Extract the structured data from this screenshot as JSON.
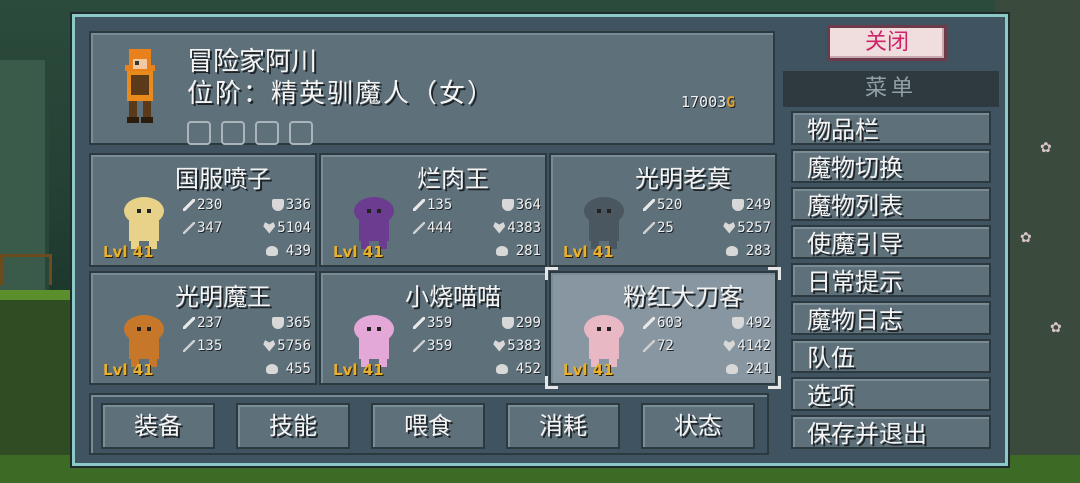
{
  "player": {
    "name": "冒险家阿川",
    "rank": "位阶：精英驯魔人（女）",
    "gold_amount": "17003",
    "gold_icon": "G",
    "equipment_slots": [
      "weapon-slot-icon",
      "armor-slot-icon",
      "helmet-slot-icon",
      "accessory-slot-icon"
    ]
  },
  "monsters": [
    {
      "name": "国服喷子",
      "level": "Lvl 41",
      "atk": "230",
      "def": "336",
      "matk": "347",
      "hp": "5104",
      "food": "439",
      "sprite": "mushroom-sprite",
      "color": "#e8d28a"
    },
    {
      "name": "烂肉王",
      "level": "Lvl 41",
      "atk": "135",
      "def": "364",
      "matk": "444",
      "hp": "4383",
      "food": "281",
      "sprite": "purple-beast-sprite",
      "color": "#6b3c8f"
    },
    {
      "name": "光明老莫",
      "level": "Lvl 41",
      "atk": "520",
      "def": "249",
      "matk": "25",
      "hp": "5257",
      "food": "283",
      "sprite": "dark-wolf-sprite",
      "color": "#4a5660"
    },
    {
      "name": "光明魔王",
      "level": "Lvl 41",
      "atk": "237",
      "def": "365",
      "matk": "135",
      "hp": "5756",
      "food": "455",
      "sprite": "ram-centaur-sprite",
      "color": "#c7772a"
    },
    {
      "name": "小烧喵喵",
      "level": "Lvl 41",
      "atk": "359",
      "def": "299",
      "matk": "359",
      "hp": "5383",
      "food": "452",
      "sprite": "pink-cat-sprite",
      "color": "#e4a8d8"
    },
    {
      "name": "粉红大刀客",
      "level": "Lvl 41",
      "atk": "603",
      "def": "492",
      "matk": "72",
      "hp": "4142",
      "food": "241",
      "sprite": "pink-mantis-sprite",
      "color": "#e8b8c4"
    }
  ],
  "actions": [
    "装备",
    "技能",
    "喂食",
    "消耗",
    "状态"
  ],
  "close_label": "关闭",
  "menu": {
    "title": "菜单",
    "items": [
      "物品栏",
      "魔物切换",
      "魔物列表",
      "使魔引导",
      "日常提示",
      "魔物日志",
      "队伍",
      "选项",
      "保存并退出"
    ]
  }
}
